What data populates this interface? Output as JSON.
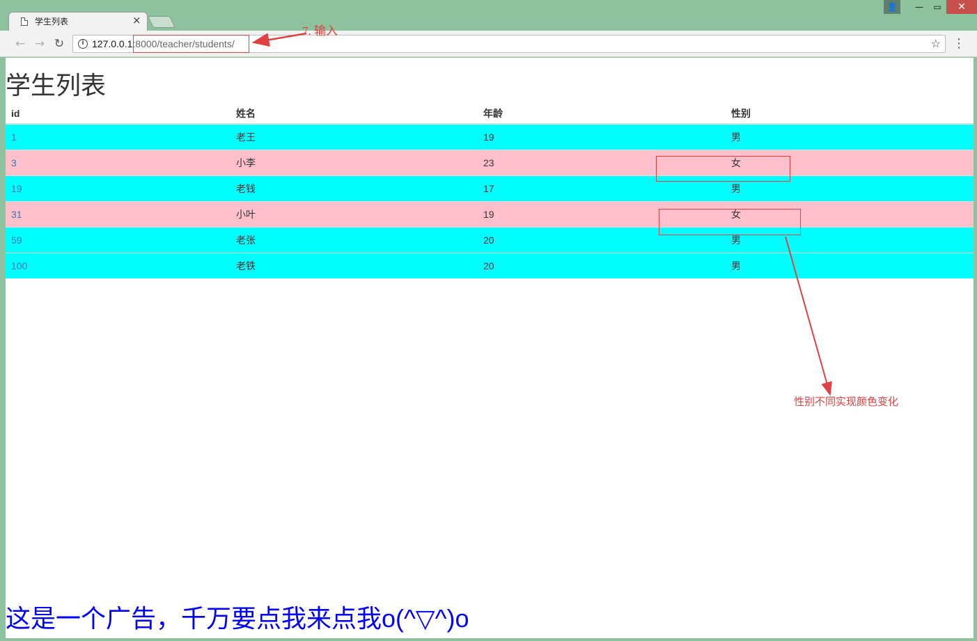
{
  "browser": {
    "tab_title": "学生列表",
    "tab_close": "×",
    "url_host": "127.0.0.1",
    "url_rest": ":8000/teacher/students/",
    "back": "←",
    "forward": "→",
    "reload": "↻",
    "star": "☆",
    "menu": "⋮",
    "info": "i",
    "win_user": "👤",
    "win_min": "—",
    "win_max": "▭",
    "win_close": "✕"
  },
  "page": {
    "heading": "学生列表",
    "columns": [
      "id",
      "姓名",
      "年龄",
      "性别"
    ],
    "rows": [
      {
        "id": "1",
        "name": "老王",
        "age": "19",
        "gender": "男",
        "kind": "male"
      },
      {
        "id": "3",
        "name": "小李",
        "age": "23",
        "gender": "女",
        "kind": "female"
      },
      {
        "id": "19",
        "name": "老钱",
        "age": "17",
        "gender": "男",
        "kind": "male"
      },
      {
        "id": "31",
        "name": "小叶",
        "age": "19",
        "gender": "女",
        "kind": "female"
      },
      {
        "id": "59",
        "name": "老张",
        "age": "20",
        "gender": "男",
        "kind": "male"
      },
      {
        "id": "100",
        "name": "老铁",
        "age": "20",
        "gender": "男",
        "kind": "male"
      }
    ],
    "ad_text": "这是一个广告，千万要点我来点我o(^▽^)o"
  },
  "annotations": {
    "step_label": "7. 输入",
    "color_note": "性别不同实现颜色变化",
    "color": "#e04040"
  },
  "colors": {
    "male_row": "#00ffff",
    "female_row": "#ffc0cb",
    "ad": "#0000ff",
    "frame": "#8ec29e"
  }
}
